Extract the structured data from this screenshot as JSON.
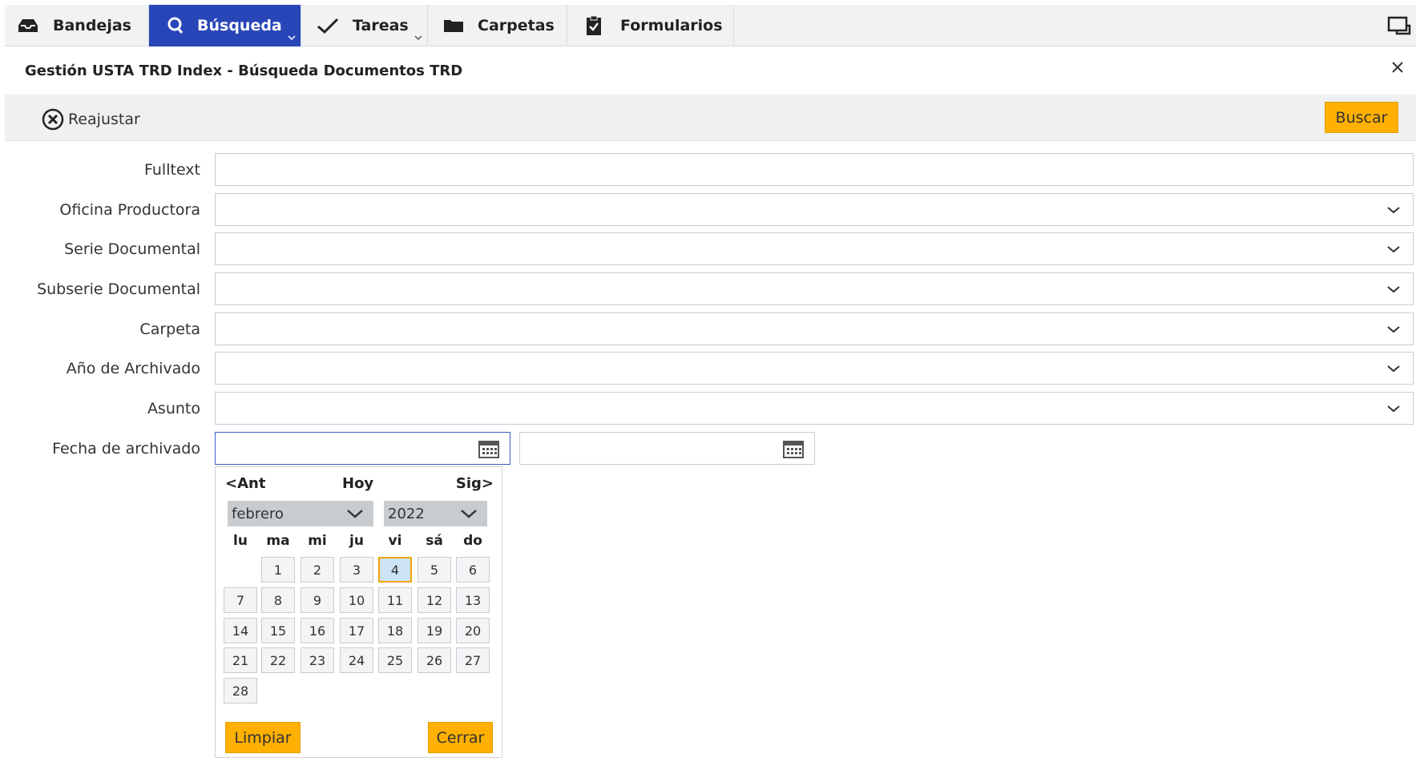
{
  "nav": {
    "tabs": [
      {
        "label": "Bandejas",
        "icon": "inbox-icon"
      },
      {
        "label": "Búsqueda",
        "icon": "search-icon"
      },
      {
        "label": "Tareas",
        "icon": "check-icon"
      },
      {
        "label": "Carpetas",
        "icon": "folder-icon"
      },
      {
        "label": "Formularios",
        "icon": "clipboard-icon"
      }
    ],
    "active_tab": "Búsqueda",
    "accent_color": "#2846b8"
  },
  "dialog": {
    "title": "Gestión USTA TRD Index - Búsqueda Documentos TRD"
  },
  "toolbar": {
    "reset_label": "Reajustar",
    "search_label": "Buscar",
    "button_color": "#ffb000"
  },
  "form": {
    "fields": [
      {
        "label": "Fulltext",
        "type": "text",
        "value": ""
      },
      {
        "label": "Oficina Productora",
        "type": "select",
        "value": ""
      },
      {
        "label": "Serie Documental",
        "type": "select",
        "value": ""
      },
      {
        "label": "Subserie Documental",
        "type": "select",
        "value": ""
      },
      {
        "label": "Carpeta",
        "type": "select",
        "value": ""
      },
      {
        "label": "Año de Archivado",
        "type": "select",
        "value": ""
      },
      {
        "label": "Asunto",
        "type": "select",
        "value": ""
      }
    ],
    "date_label": "Fecha de archivado",
    "date_from": "",
    "date_to": ""
  },
  "datepicker": {
    "prev_label": "<Ant",
    "today_label": "Hoy",
    "next_label": "Sig>",
    "month": "febrero",
    "year": "2022",
    "weekdays": [
      "lu",
      "ma",
      "mi",
      "ju",
      "vi",
      "sá",
      "do"
    ],
    "days": [
      "1",
      "2",
      "3",
      "4",
      "5",
      "6",
      "7",
      "8",
      "9",
      "10",
      "11",
      "12",
      "13",
      "14",
      "15",
      "16",
      "17",
      "18",
      "19",
      "20",
      "21",
      "22",
      "23",
      "24",
      "25",
      "26",
      "27",
      "28"
    ],
    "first_weekday_index": 1,
    "today": "4",
    "clear_label": "Limpiar",
    "close_label": "Cerrar"
  }
}
